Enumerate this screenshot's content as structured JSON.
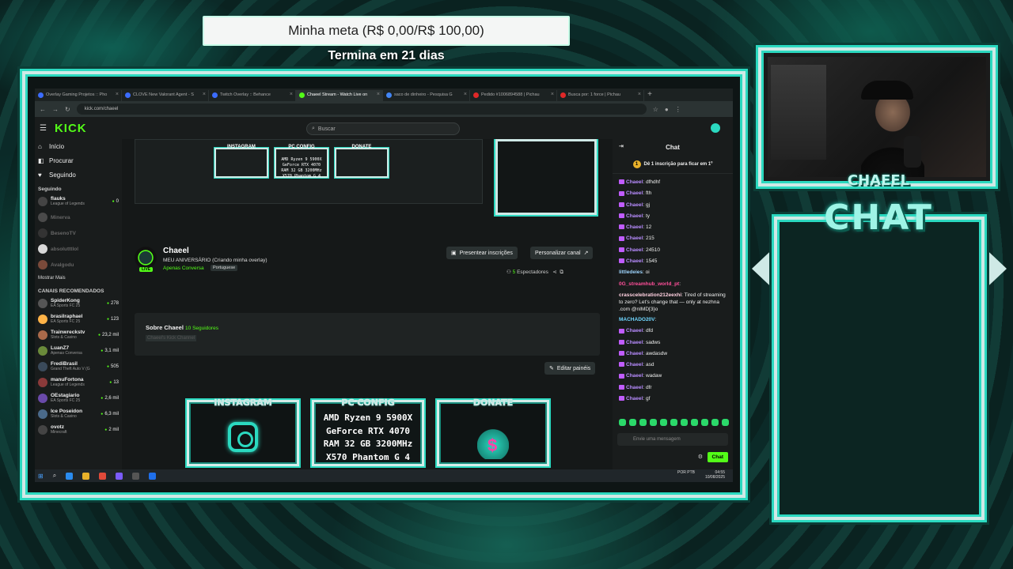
{
  "goal": {
    "title": "Minha meta (R$ 0,00/R$ 100,00)",
    "subtitle": "Termina em 21 dias",
    "progress": 0
  },
  "browser": {
    "tabs": [
      {
        "label": "Overlay Gaming Projetos :: Pho",
        "color": "#3b6cff"
      },
      {
        "label": "CLOVE New Valorant Agent - S",
        "color": "#3b6cff"
      },
      {
        "label": "Twitch Overlay :: Behance",
        "color": "#3b6cff"
      },
      {
        "label": "Chaeel Stream - Watch Live on",
        "color": "#53fc18",
        "active": true
      },
      {
        "label": "saco de dinheiro - Pesquisa G",
        "color": "#4285f4"
      },
      {
        "label": "Pedido #1006894588 | Pichau",
        "color": "#e02828"
      },
      {
        "label": "Busca por: 1 force | Pichau",
        "color": "#e02828"
      }
    ],
    "url": "kick.com/chaeel"
  },
  "kick": {
    "logo": "KICK",
    "search_placeholder": "Buscar",
    "nav": [
      {
        "label": "Início",
        "icon": "home-icon"
      },
      {
        "label": "Procurar",
        "icon": "browse-icon"
      },
      {
        "label": "Seguindo",
        "icon": "heart-icon"
      }
    ],
    "following_title": "Seguindo",
    "following": [
      {
        "name": "flauks",
        "game": "League of Legends",
        "viewers": "0",
        "live": true
      },
      {
        "name": "Minerva",
        "game": "",
        "viewers": "",
        "live": false
      },
      {
        "name": "BesenoTV",
        "game": "",
        "viewers": "",
        "live": false
      },
      {
        "name": "absolutttlol",
        "game": "",
        "viewers": "",
        "live": false
      },
      {
        "name": "Avalgodu",
        "game": "",
        "viewers": "",
        "live": false
      }
    ],
    "show_more": "Mostrar Mais",
    "recommended_title": "CANAIS RECOMENDADOS",
    "recommended": [
      {
        "name": "SpiderKong",
        "game": "EA Sports FC 25",
        "viewers": "278"
      },
      {
        "name": "brasilraphael",
        "game": "EA Sports FC 25",
        "viewers": "123"
      },
      {
        "name": "Trainwreckstv",
        "game": "Slots & Casino",
        "viewers": "23,2 mil"
      },
      {
        "name": "LuanZ7",
        "game": "Apenas Conversa",
        "viewers": "3,1 mil"
      },
      {
        "name": "FrediBrasil",
        "game": "Grand Theft Auto V (G",
        "viewers": "505"
      },
      {
        "name": "manuFortona",
        "game": "League of Legends",
        "viewers": "13"
      },
      {
        "name": "OEstagiario",
        "game": "EA Sports FC 25",
        "viewers": "2,6 mil"
      },
      {
        "name": "Ice Poseidon",
        "game": "Slots & Casino",
        "viewers": "6,3 mil"
      },
      {
        "name": "ovotz",
        "game": "Minecraft",
        "viewers": "2 mil"
      }
    ],
    "channel": {
      "name": "Chaeel",
      "live_badge": "LIVE",
      "title": "MEU ANIVERSÁRIO (Criando minha overlay)",
      "category": "Apenas Conversa",
      "language": "Portuguese",
      "btn_gift": "Presentear inscrições",
      "btn_custom": "Personalizar canal",
      "viewers": "5",
      "viewers_label": "Espectadores"
    },
    "about": {
      "title": "Sobre Chaeel",
      "followers": "10 Seguidores",
      "hint": "Chaeel's Kick Channel"
    },
    "edit_panels": "Editar painéis",
    "panels": {
      "instagram": "INSTAGRAM",
      "config": "PC CONFIG",
      "config_lines": [
        "AMD Ryzen 9 5900X",
        "GeForce RTX 4070",
        "RAM 32 GB 3200MHz",
        "X570 Phantom G 4"
      ],
      "donate": "DONATE"
    },
    "chat": {
      "title": "Chat",
      "pinned": "Dê 1 inscrição para ficar em 1º",
      "messages": [
        {
          "user": "Chaeel",
          "text": "dfhdhf",
          "color": "#b88cff",
          "badge": true
        },
        {
          "user": "Chaeel",
          "text": "fth",
          "color": "#b88cff",
          "badge": true
        },
        {
          "user": "Chaeel",
          "text": "gj",
          "color": "#b88cff",
          "badge": true
        },
        {
          "user": "Chaeel",
          "text": "ty",
          "color": "#b88cff",
          "badge": true
        },
        {
          "user": "Chaeel",
          "text": "12",
          "color": "#b88cff",
          "badge": true
        },
        {
          "user": "Chaeel",
          "text": "215",
          "color": "#b88cff",
          "badge": true
        },
        {
          "user": "Chaeel",
          "text": "24510",
          "color": "#b88cff",
          "badge": true
        },
        {
          "user": "Chaeel",
          "text": "1545",
          "color": "#b88cff",
          "badge": true
        },
        {
          "user": "littledeies",
          "text": "oi",
          "color": "#9fd6ff",
          "badge": false
        },
        {
          "user": "0G_streamhub_world_pt",
          "text": "",
          "color": "#ff4f9a",
          "badge": false
        },
        {
          "user": "crasscelebration212eexhi",
          "text": "Tired of streaming to zero? Let's change that — only at nezhna .com @nIMD[3}o",
          "color": "#ffd0e0",
          "badge": false,
          "long": true
        },
        {
          "user": "MACHADO20V",
          "text": "",
          "color": "#6fd6ff",
          "badge": false
        },
        {
          "user": "Chaeel",
          "text": "dfd",
          "color": "#b88cff",
          "badge": true
        },
        {
          "user": "Chaeel",
          "text": "sadws",
          "color": "#b88cff",
          "badge": true
        },
        {
          "user": "Chaeel",
          "text": "awdasdw",
          "color": "#b88cff",
          "badge": true
        },
        {
          "user": "Chaeel",
          "text": "asd",
          "color": "#b88cff",
          "badge": true
        },
        {
          "user": "Chaeel",
          "text": "wadaw",
          "color": "#b88cff",
          "badge": true
        },
        {
          "user": "Chaeel",
          "text": "dfr",
          "color": "#b88cff",
          "badge": true
        },
        {
          "user": "Chaeel",
          "text": "gf",
          "color": "#b88cff",
          "badge": true
        }
      ],
      "input_placeholder": "Envie uma mensagem",
      "send": "Chat"
    }
  },
  "taskbar": {
    "lang": "POR PTB",
    "time": "04:55",
    "date": "10/08/2025"
  },
  "overlay": {
    "cam_name": "CHAEEL",
    "chat_title": "CHAT"
  },
  "colors": {
    "accent": "#2bd9c0",
    "kick_green": "#53fc18"
  }
}
